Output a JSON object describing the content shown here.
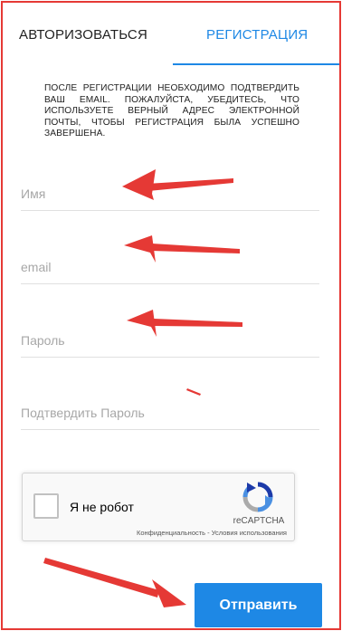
{
  "tabs": {
    "login": "АВТОРИЗОВАТЬСЯ",
    "register": "РЕГИСТРАЦИЯ",
    "active": "register"
  },
  "notice": "После регистрации необходимо подтвердить ваш email. Пожалуйста, убедитесь, что используете верный адрес электронной почты, чтобы регистрация была успешно завершена.",
  "form": {
    "name_placeholder": "Имя",
    "email_placeholder": "email",
    "password_placeholder": "Пароль",
    "confirm_placeholder": "Подтвердить Пароль"
  },
  "captcha": {
    "label": "Я не робот",
    "brand": "reCAPTCHA",
    "privacy": "Конфиденциальность",
    "separator": " - ",
    "terms": "Условия использования"
  },
  "submit_label": "Отправить",
  "colors": {
    "accent": "#1e88e5",
    "annotation": "#e53935"
  }
}
